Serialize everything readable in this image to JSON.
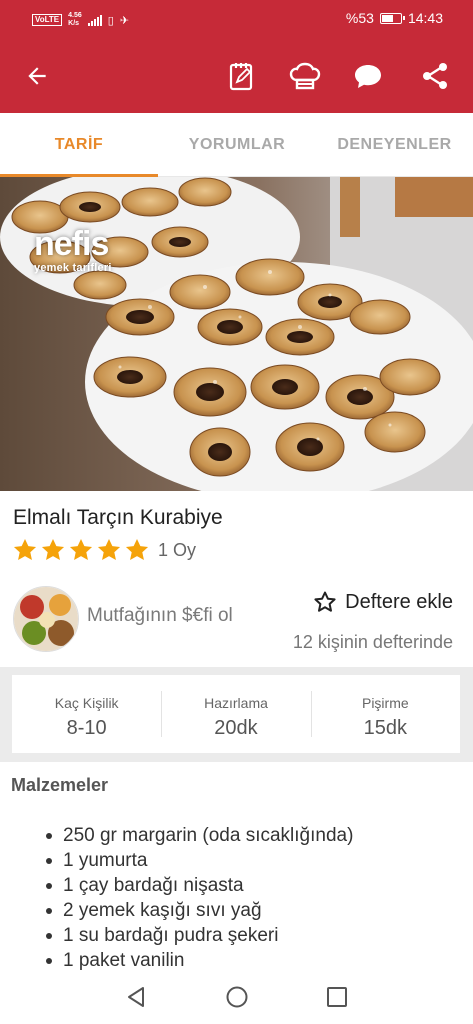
{
  "status_bar": {
    "network": "VoLTE",
    "data_speed": "4.56",
    "data_unit": "K/s",
    "battery": "%53",
    "battery_level": 0.53,
    "time": "14:43"
  },
  "app_bar": {
    "icons": [
      "back-arrow-icon",
      "notepad-icon",
      "chef-hat-icon",
      "comment-icon",
      "share-icon"
    ],
    "color": "#c62a38"
  },
  "tabs": [
    {
      "label": "TARİF",
      "active": true
    },
    {
      "label": "YORUMLAR",
      "active": false
    },
    {
      "label": "DENEYENLER",
      "active": false
    }
  ],
  "hero": {
    "watermark_logo": "nefis",
    "watermark_sub": "yemek tarifleri"
  },
  "recipe": {
    "title": "Elmalı Tarçın Kurabiye",
    "stars": 5,
    "rating_count": "1 Oy",
    "author": "Mutfağının $€fi ol",
    "save_label": "Deftere ekle",
    "saved_count": "12 kişinin defterinde"
  },
  "info": [
    {
      "label": "Kaç Kişilik",
      "value": "8-10"
    },
    {
      "label": "Hazırlama",
      "value": "20dk"
    },
    {
      "label": "Pişirme",
      "value": "15dk"
    }
  ],
  "ingredients_title": "Malzemeler",
  "ingredients": [
    "250 gr margarin (oda sıcaklığında)",
    "1 yumurta",
    "1 çay bardağı nişasta",
    "2 yemek kaşığı sıvı yağ",
    "1 su bardağı pudra şekeri",
    "1 paket vanilin"
  ],
  "colors": {
    "brand": "#c62a38",
    "tab_active": "#e8892a",
    "star": "#f5a30a"
  },
  "nav_bar": {
    "buttons": [
      "back-triangle-icon",
      "home-circle-icon",
      "recents-square-icon"
    ]
  }
}
